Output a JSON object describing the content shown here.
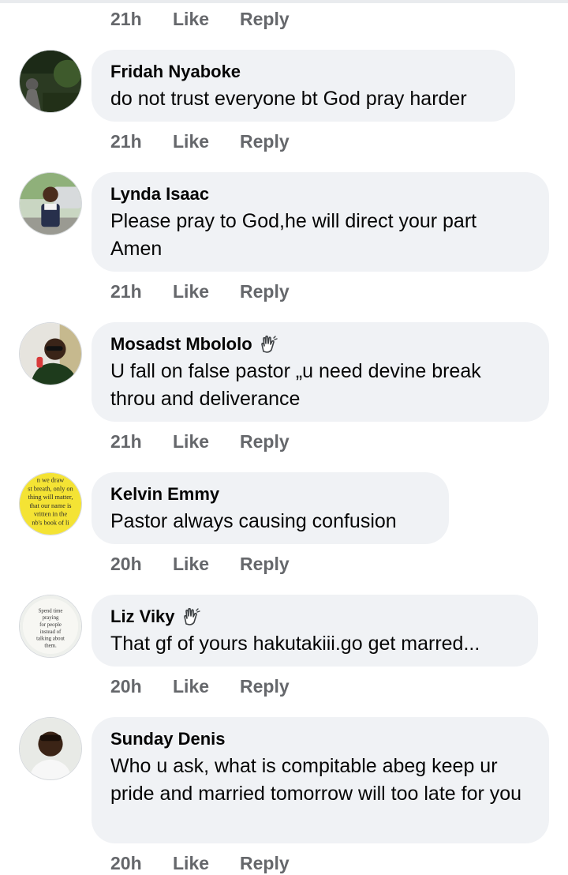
{
  "actions": {
    "like": "Like",
    "reply": "Reply"
  },
  "top_meta": {
    "time": "21h"
  },
  "comments": [
    {
      "name": "Fridah Nyaboke",
      "text": "do not trust everyone bt God pray harder",
      "time": "21h",
      "badge": false,
      "avatar_icon": "photo-silhouette-icon"
    },
    {
      "name": "Lynda Isaac",
      "text": "Please pray to God,he will direct your part Amen",
      "time": "21h",
      "badge": false,
      "avatar_icon": "photo-child-icon"
    },
    {
      "name": "Mosadst Mbololo",
      "text": "U fall on false pastor „u need devine break throu and deliverance",
      "time": "21h",
      "badge": true,
      "avatar_icon": "photo-man-sunglasses-icon"
    },
    {
      "name": "Kelvin Emmy",
      "text": "Pastor always causing confusion",
      "time": "20h",
      "badge": false,
      "avatar_icon": "quote-card-icon",
      "avatar_text": [
        "n we draw",
        "st breath, only on",
        "thing will matter,",
        "that our name is",
        "vritten in the",
        "nb's book of li"
      ]
    },
    {
      "name": "Liz Viky",
      "text": "That gf of yours hakutakiii.go get marred...",
      "time": "20h",
      "badge": true,
      "avatar_icon": "quote-card-icon",
      "avatar_text": [
        "Spend time",
        "praying",
        "for people",
        "instead of",
        "talking about",
        "them."
      ]
    },
    {
      "name": "Sunday Denis",
      "text": "Who u ask, what is compitable  abeg keep ur pride and married tomorrow will too late for you",
      "time": "20h",
      "badge": false,
      "avatar_icon": "photo-man-portrait-icon"
    }
  ],
  "colors": {
    "bubble": "#f0f2f5",
    "meta": "#65676b",
    "text": "#050505"
  }
}
